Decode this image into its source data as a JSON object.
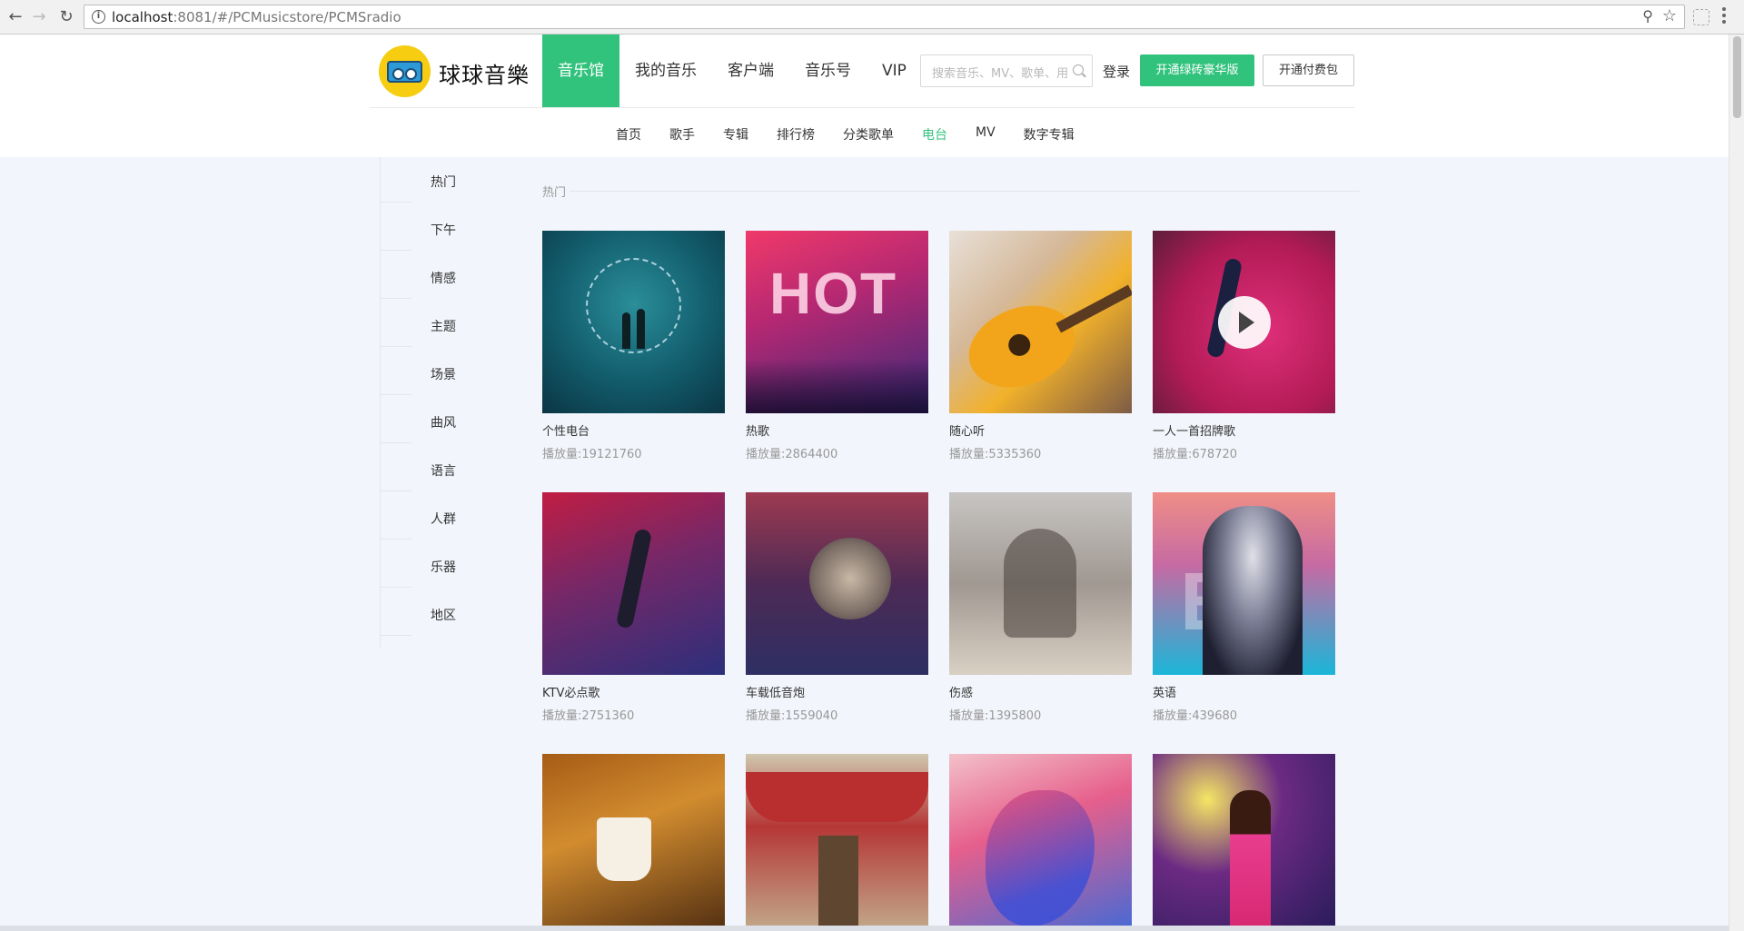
{
  "browser": {
    "url_host": "localhost",
    "url_rest": ":8081/#/PCMusicstore/PCMSradio"
  },
  "header": {
    "logo_text": "球球音樂",
    "nav": [
      {
        "label": "音乐馆",
        "active": true
      },
      {
        "label": "我的音乐",
        "active": false
      },
      {
        "label": "客户端",
        "active": false
      },
      {
        "label": "音乐号",
        "active": false
      },
      {
        "label": "VIP",
        "active": false
      }
    ],
    "search_placeholder": "搜索音乐、MV、歌单、用户",
    "login_label": "登录",
    "green_button": "开通绿砖豪华版",
    "white_button": "开通付费包",
    "accent_color": "#31c27c"
  },
  "subnav": [
    {
      "label": "首页",
      "active": false
    },
    {
      "label": "歌手",
      "active": false
    },
    {
      "label": "专辑",
      "active": false
    },
    {
      "label": "排行榜",
      "active": false
    },
    {
      "label": "分类歌单",
      "active": false
    },
    {
      "label": "电台",
      "active": true
    },
    {
      "label": "MV",
      "active": false
    },
    {
      "label": "数字专辑",
      "active": false
    }
  ],
  "sidebar": {
    "categories": [
      "热门",
      "下午",
      "情感",
      "主题",
      "场景",
      "曲风",
      "语言",
      "人群",
      "乐器",
      "地区"
    ]
  },
  "main": {
    "section_title": "热门",
    "cards": [
      {
        "title": "个性电台",
        "plays": "播放量:19121760",
        "art": "music-note-couple"
      },
      {
        "title": "热歌",
        "plays": "播放量:2864400",
        "art": "hot-concert"
      },
      {
        "title": "随心听",
        "plays": "播放量:5335360",
        "art": "guitar"
      },
      {
        "title": "一人一首招牌歌",
        "plays": "播放量:678720",
        "art": "singer-red"
      },
      {
        "title": "KTV必点歌",
        "plays": "播放量:2751360",
        "art": "singer-stage"
      },
      {
        "title": "车载低音炮",
        "plays": "播放量:1559040",
        "art": "car-knob"
      },
      {
        "title": "伤感",
        "plays": "播放量:1395800",
        "art": "silhouette"
      },
      {
        "title": "英语",
        "plays": "播放量:439680",
        "art": "portrait"
      },
      {
        "title": "",
        "plays": "",
        "art": "coffee"
      },
      {
        "title": "",
        "plays": "",
        "art": "storefront"
      },
      {
        "title": "",
        "plays": "",
        "art": "paint-splash"
      },
      {
        "title": "",
        "plays": "",
        "art": "diva"
      }
    ]
  }
}
